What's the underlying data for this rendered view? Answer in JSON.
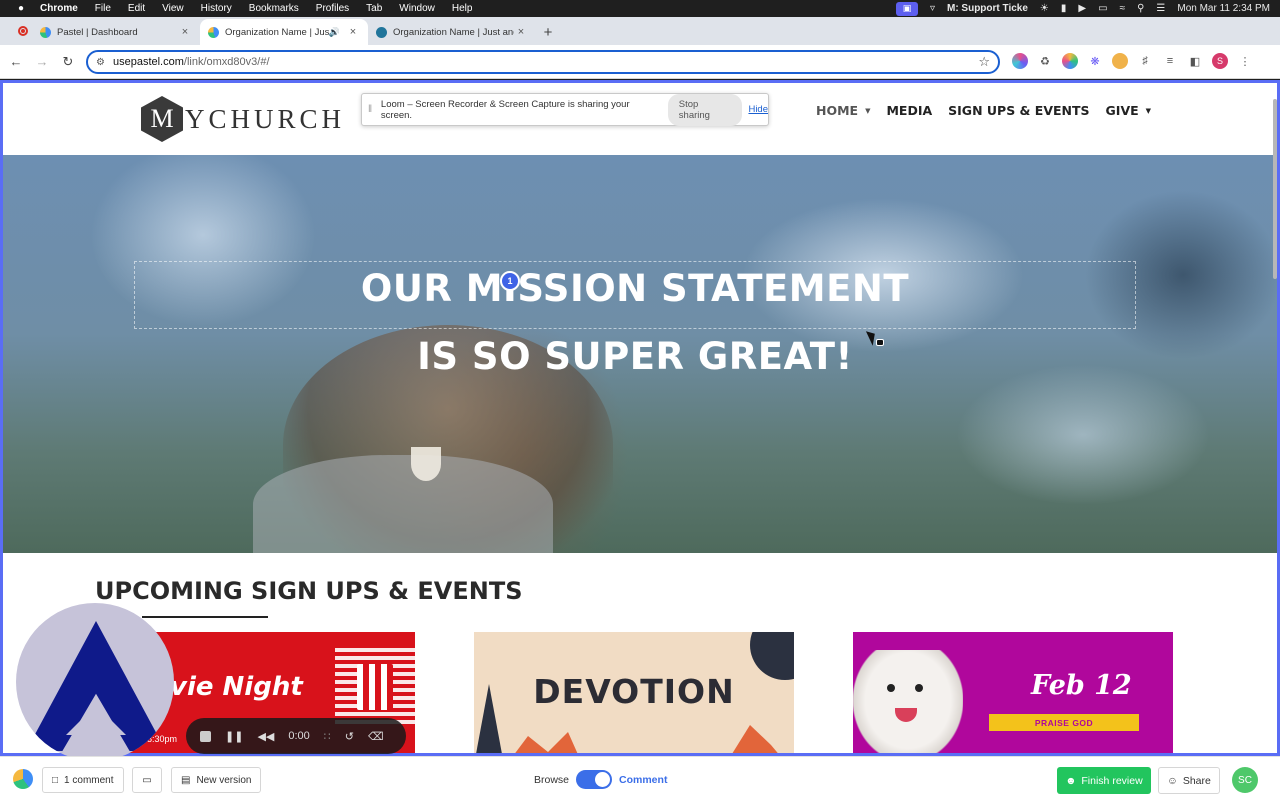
{
  "menubar": {
    "app": "Chrome",
    "items": [
      "File",
      "Edit",
      "View",
      "History",
      "Bookmarks",
      "Profiles",
      "Tab",
      "Window",
      "Help"
    ],
    "status_text": "M: Support Ticke",
    "datetime": "Mon Mar 11  2:34 PM"
  },
  "tabs": [
    {
      "title": "Pastel | Dashboard",
      "active": false
    },
    {
      "title": "Organization Name | Just",
      "active": true
    },
    {
      "title": "Organization Name | Just and",
      "active": false
    }
  ],
  "toolbar": {
    "url_host": "usepastel.com",
    "url_path": "/link/omxd80v3/#/",
    "profile_initial": "S"
  },
  "loom": {
    "message": "Loom – Screen Recorder & Screen Capture is sharing your screen.",
    "stop_label": "Stop sharing",
    "hide_label": "Hide"
  },
  "site": {
    "logo_letter": "M",
    "logo_rest": "YCHURCH",
    "nav": [
      {
        "label": "HOME",
        "has_caret": true
      },
      {
        "label": "MEDIA",
        "has_caret": false
      },
      {
        "label": "SIGN UPS & EVENTS",
        "has_caret": false
      },
      {
        "label": "GIVE",
        "has_caret": true
      }
    ],
    "hero_line1_a": "OUR ",
    "hero_line1_b": "MISSION STATEMENT",
    "hero_line2": "IS SO SUPER GREAT!",
    "comment_pin": "1",
    "section_heading": "UPCOMING SIGN UPS & EVENTS",
    "cards": [
      {
        "title": "vie Night",
        "time": "8:30pm"
      },
      {
        "title": "DEVOTION"
      },
      {
        "title": "Feb 12",
        "banner": "PRAISE GOD"
      }
    ]
  },
  "player": {
    "time": "0:00"
  },
  "review": {
    "comments_label": "1 comment",
    "new_version_label": "New version",
    "browse_label": "Browse",
    "comment_label": "Comment",
    "finish_label": "Finish review",
    "share_label": "Share",
    "avatar": "SC"
  },
  "colors": {
    "accent": "#3b6ee8",
    "finish_green": "#22c55e",
    "viewport_border": "#5a6df5"
  }
}
